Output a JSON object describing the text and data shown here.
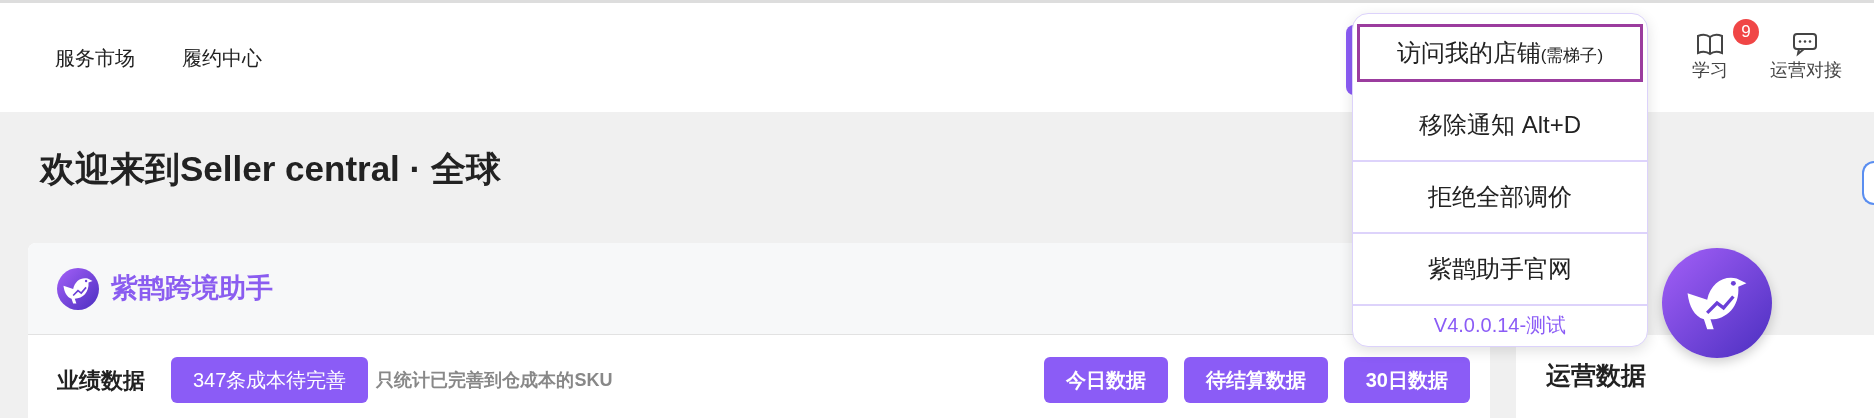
{
  "nav": [
    {
      "label": "服务市场"
    },
    {
      "label": "履约中心"
    }
  ],
  "header_actions": [
    {
      "kind": "book",
      "label": "学习",
      "badge": "9"
    },
    {
      "kind": "chat",
      "label": "运营对接"
    }
  ],
  "page_title": "欢迎来到Seller central · 全球",
  "card": {
    "title": "紫鹊跨境助手",
    "section": "业绩数据",
    "cost_button": "347条成本待完善",
    "hint": "只统计已完善到仓成本的SKU",
    "range_buttons": [
      {
        "label": "今日数据"
      },
      {
        "label": "待结算数据"
      },
      {
        "label": "30日数据"
      }
    ]
  },
  "side_card": {
    "title": "运营数据"
  },
  "dropdown": {
    "items": [
      {
        "label": "访问我的店铺",
        "note": "(需梯子)",
        "selected": true
      },
      {
        "label": "移除通知 Alt+D",
        "selected": false
      },
      {
        "label": "拒绝全部调价",
        "selected": false
      },
      {
        "label": "紫鹊助手官网",
        "selected": false
      }
    ],
    "version": "V4.0.0.14-测试"
  }
}
